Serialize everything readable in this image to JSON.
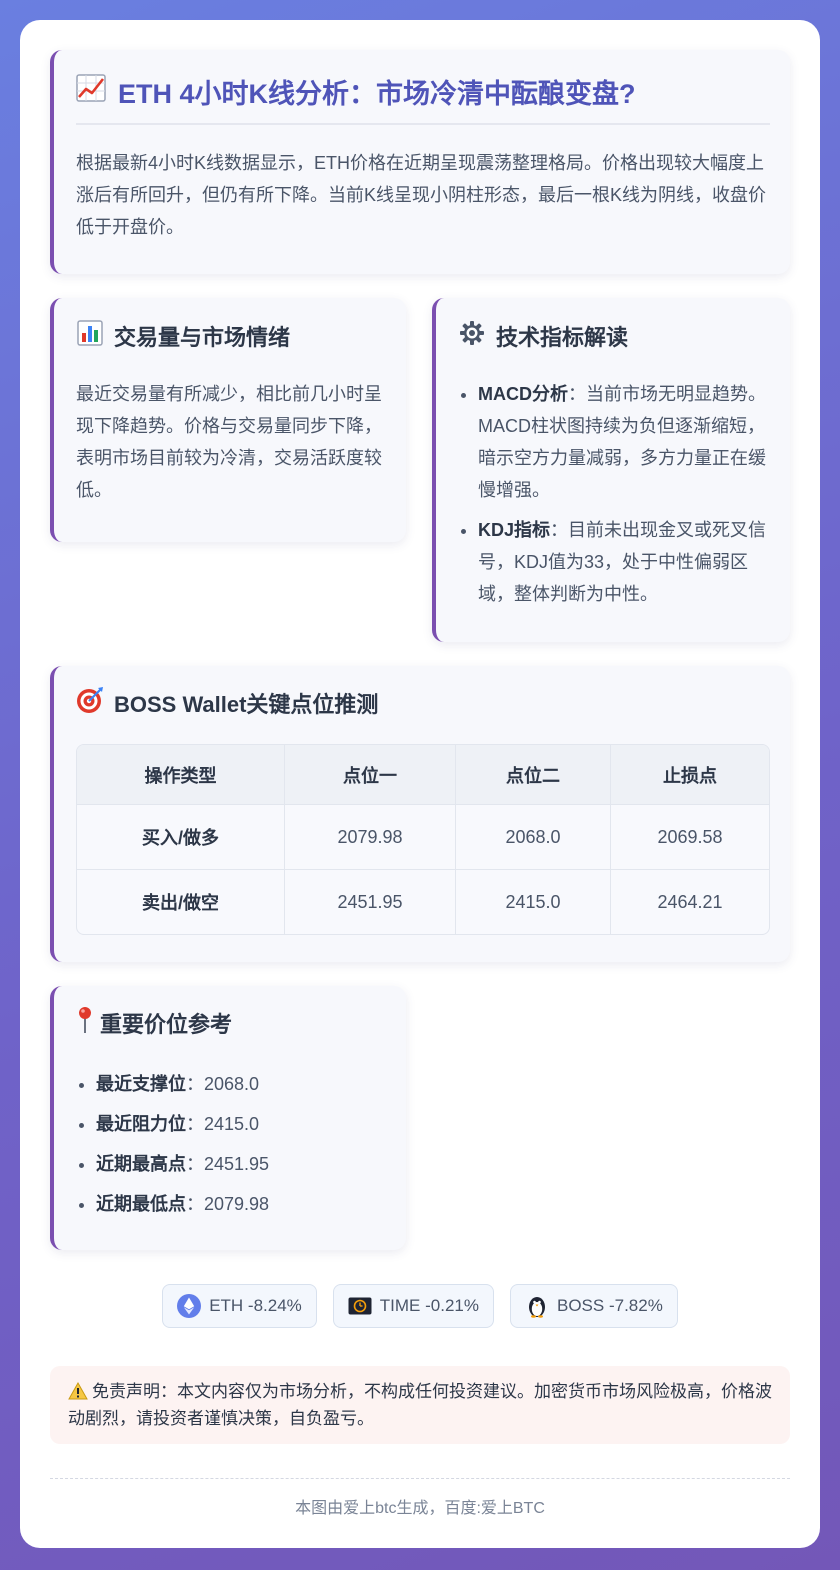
{
  "header": {
    "title": "ETH 4小时K线分析：市场冷清中酝酿变盘?",
    "icon": "chart-increasing-icon",
    "summary": "根据最新4小时K线数据显示，ETH价格在近期呈现震荡整理格局。价格出现较大幅度上涨后有所回升，但仍有所下降。当前K线呈现小阴柱形态，最后一根K线为阴线，收盘价低于开盘价。"
  },
  "volume": {
    "title": "交易量与市场情绪",
    "icon": "bar-chart-icon",
    "text": "最近交易量有所减少，相比前几小时呈现下降趋势。价格与交易量同步下降，表明市场目前较为冷清，交易活跃度较低。"
  },
  "tech": {
    "title": "技术指标解读",
    "icon": "gear-icon",
    "items": [
      {
        "label": "MACD分析",
        "sep": "：",
        "text": "当前市场无明显趋势。MACD柱状图持续为负但逐渐缩短，暗示空方力量减弱，多方力量正在缓慢增强。"
      },
      {
        "label": "KDJ指标",
        "sep": "：",
        "text": "目前未出现金叉或死叉信号，KDJ值为33，处于中性偏弱区域，整体判断为中性。"
      }
    ]
  },
  "boss": {
    "title": "BOSS Wallet关键点位推测",
    "icon": "target-icon",
    "columns": [
      "操作类型",
      "点位一",
      "点位二",
      "止损点"
    ],
    "rows": [
      [
        "买入/做多",
        "2079.98",
        "2068.0",
        "2069.58"
      ],
      [
        "卖出/做空",
        "2451.95",
        "2415.0",
        "2464.21"
      ]
    ]
  },
  "levels": {
    "title": "重要价位参考",
    "icon": "pushpin-icon",
    "items": [
      {
        "label": "最近支撑位",
        "sep": "：",
        "value": "2068.0"
      },
      {
        "label": "最近阻力位",
        "sep": "：",
        "value": "2415.0"
      },
      {
        "label": "近期最高点",
        "sep": "：",
        "value": "2451.95"
      },
      {
        "label": "近期最低点",
        "sep": "：",
        "value": "2079.98"
      }
    ]
  },
  "coins": [
    {
      "icon": "ethereum-icon",
      "text": "ETH -8.24%"
    },
    {
      "icon": "time-coin-icon",
      "text": "TIME -0.21%"
    },
    {
      "icon": "penguin-icon",
      "text": "BOSS -7.82%"
    }
  ],
  "disclaimer": "免责声明：本文内容仅为市场分析，不构成任何投资建议。加密货币市场风险极高，价格波动剧烈，请投资者谨慎决策，自负盈亏。",
  "footer": "本图由爱上btc生成，百度:爱上BTC",
  "colors": {
    "accent": "#7b4fb0",
    "title": "#4f54b8"
  }
}
